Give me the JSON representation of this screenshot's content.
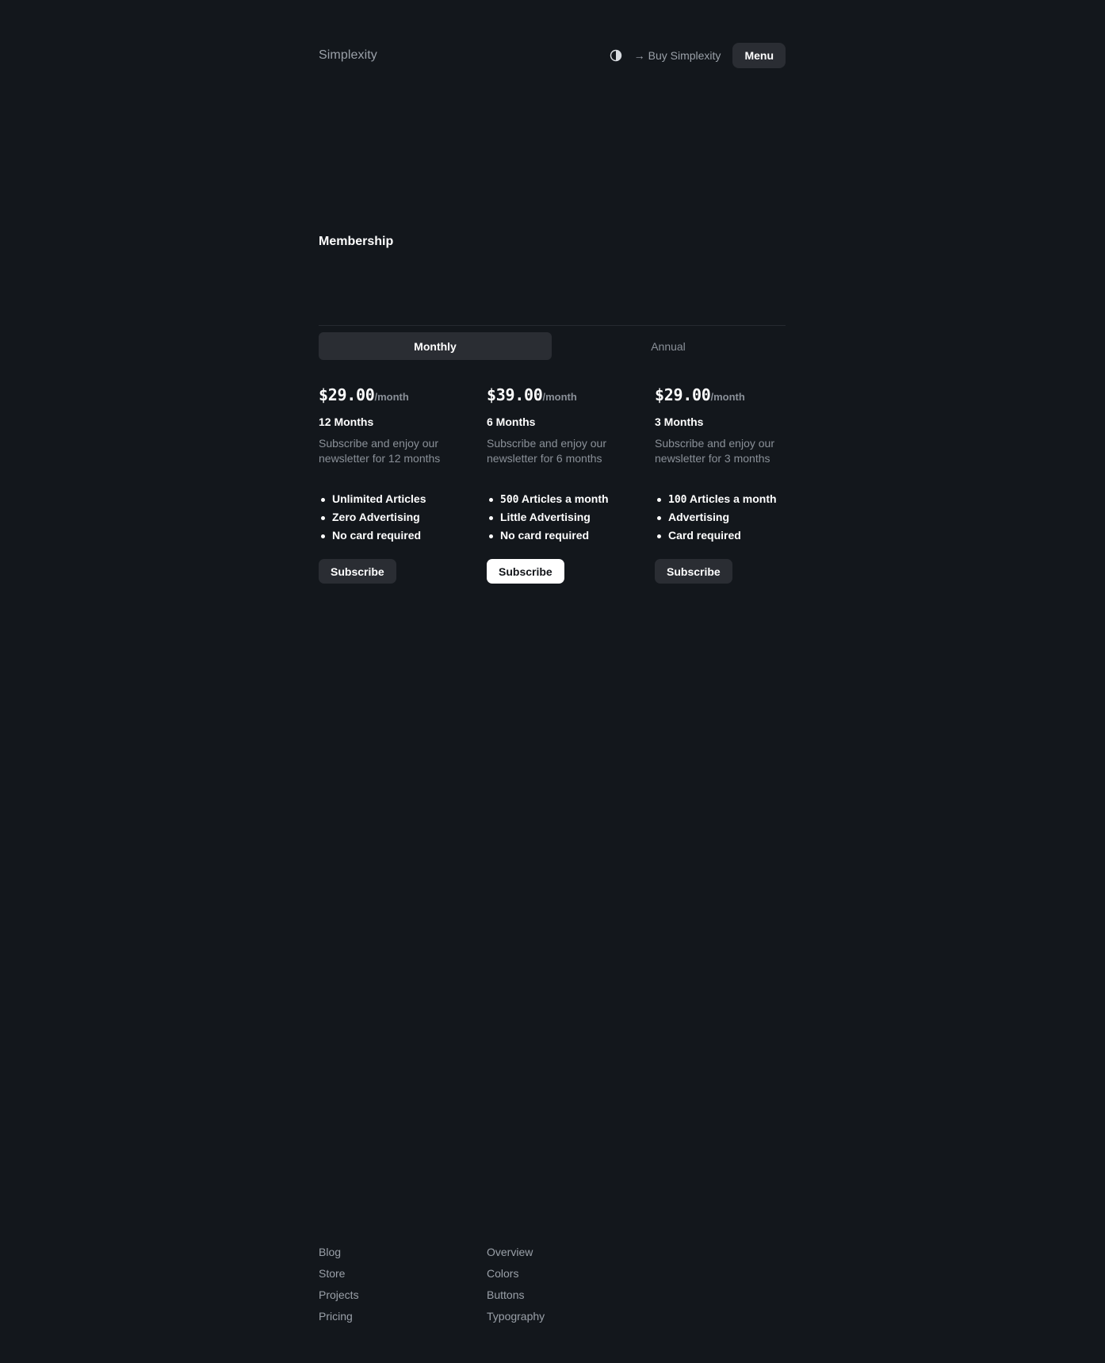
{
  "header": {
    "brand": "Simplexity",
    "theme_icon": "half-circle-icon",
    "buy_arrow": "→",
    "buy_label": "Buy Simplexity",
    "menu_label": "Menu"
  },
  "section": {
    "title": "Membership"
  },
  "tabs": [
    {
      "label": "Monthly",
      "active": true
    },
    {
      "label": "Annual",
      "active": false
    }
  ],
  "plans": [
    {
      "price": "$29.00",
      "period": "/month",
      "name": "12 Months",
      "description": "Subscribe and enjoy our newsletter for 12 months",
      "features": [
        {
          "prefix": "",
          "text": "Unlimited Articles"
        },
        {
          "prefix": "",
          "text": "Zero Advertising"
        },
        {
          "prefix": "",
          "text": "No card required"
        }
      ],
      "button": "Subscribe",
      "highlighted": false
    },
    {
      "price": "$39.00",
      "period": "/month",
      "name": "6 Months",
      "description": "Subscribe and enjoy our newsletter for 6 months",
      "features": [
        {
          "prefix": "500",
          "text": " Articles a month"
        },
        {
          "prefix": "",
          "text": "Little Advertising"
        },
        {
          "prefix": "",
          "text": "No card required"
        }
      ],
      "button": "Subscribe",
      "highlighted": true
    },
    {
      "price": "$29.00",
      "period": "/month",
      "name": "3 Months",
      "description": "Subscribe and enjoy our newsletter for 3 months",
      "features": [
        {
          "prefix": "100",
          "text": " Articles a month"
        },
        {
          "prefix": "",
          "text": "Advertising"
        },
        {
          "prefix": "",
          "text": "Card required"
        }
      ],
      "button": "Subscribe",
      "highlighted": false
    }
  ],
  "footer": {
    "columns": [
      [
        "Blog",
        "Store",
        "Projects",
        "Pricing"
      ],
      [
        "Overview",
        "Colors",
        "Buttons",
        "Typography"
      ]
    ]
  },
  "colors": {
    "background": "#13171c",
    "surface": "#2a2d33",
    "muted_text": "#8a9098",
    "text": "#ffffff"
  }
}
